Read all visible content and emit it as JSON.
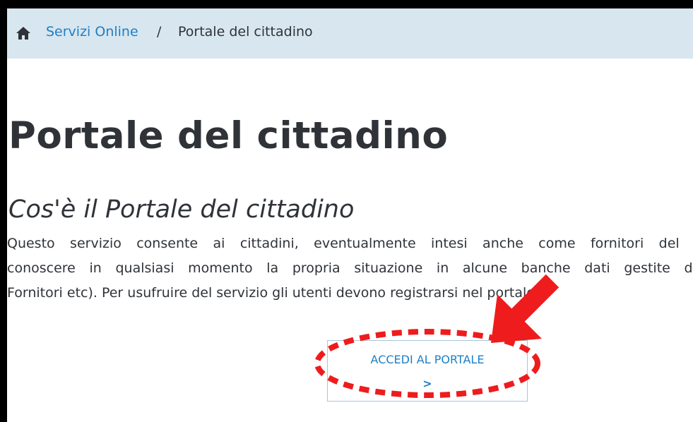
{
  "breadcrumb": {
    "home_icon": "home-icon",
    "link": "Servizi Online",
    "separator": "/",
    "current": "Portale del cittadino"
  },
  "page": {
    "title": "Portale del cittadino",
    "section_title": "Cos'è il Portale del cittadino",
    "description_lines": [
      "Questo servizio consente ai cittadini, eventualmente intesi anche come fornitori del Con",
      "conoscere in qualsiasi momento la propria situazione in alcune banche dati gestite dall'E",
      "Fornitori etc). Per usufruire del servizio gli utenti devono registrarsi nel portale."
    ]
  },
  "button": {
    "label": "ACCEDI AL PORTALE",
    "chevron": ">"
  },
  "annotation": {
    "arrow_color": "#ee1c1c",
    "ellipse_color": "#ee1c1c",
    "arrow_icon": "red-arrow-icon",
    "highlight": "dashed-ellipse-highlight"
  },
  "colors": {
    "breadcrumb_bg": "#d8e6ef",
    "link": "#1d7fc6",
    "text": "#2f3338",
    "frame": "#000000"
  }
}
